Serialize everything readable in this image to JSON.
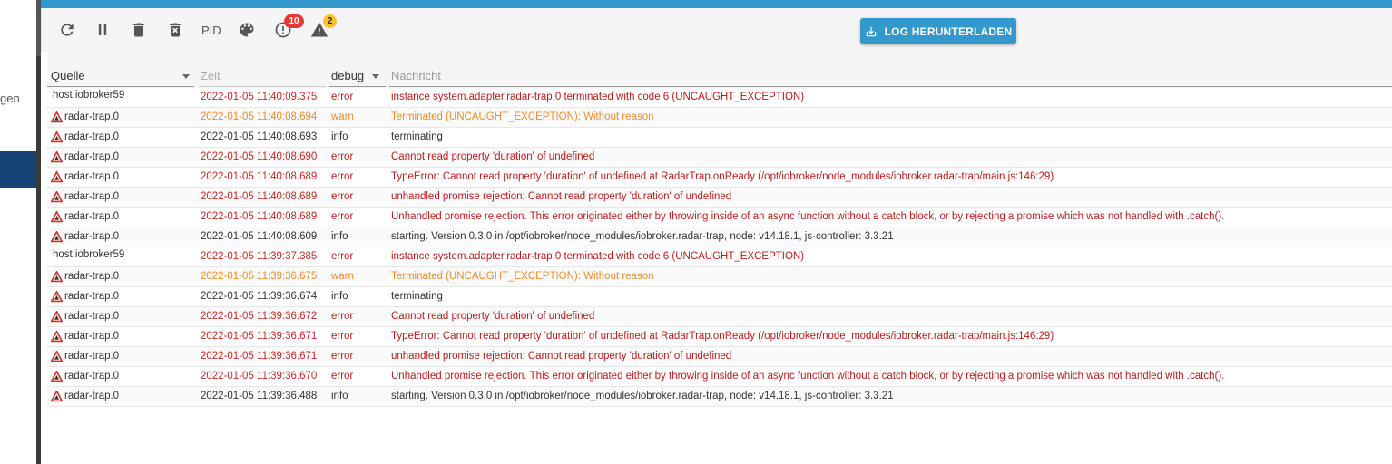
{
  "sidebar": {
    "partial_label": "gen"
  },
  "toolbar": {
    "pid_label": "PID",
    "error_count": "10",
    "warn_count": "2",
    "download_label": "LOG HERUNTERLADEN"
  },
  "table": {
    "headers": {
      "source": "Quelle",
      "time": "Zeit",
      "severity": "debug",
      "message": "Nachricht"
    },
    "rows": [
      {
        "source": "host.iobroker59",
        "icon": "none",
        "time": "2022-01-05 11:40:09.375",
        "severity": "error",
        "message": "instance system.adapter.radar-trap.0 terminated with code 6 (UNCAUGHT_EXCEPTION)"
      },
      {
        "source": "radar-trap.0",
        "icon": "radar-trap-icon",
        "time": "2022-01-05 11:40:08.694",
        "severity": "warn",
        "message": "Terminated (UNCAUGHT_EXCEPTION): Without reason"
      },
      {
        "source": "radar-trap.0",
        "icon": "radar-trap-icon",
        "time": "2022-01-05 11:40:08.693",
        "severity": "info",
        "message": "terminating"
      },
      {
        "source": "radar-trap.0",
        "icon": "radar-trap-icon",
        "time": "2022-01-05 11:40:08.690",
        "severity": "error",
        "message": "Cannot read property 'duration' of undefined"
      },
      {
        "source": "radar-trap.0",
        "icon": "radar-trap-icon",
        "time": "2022-01-05 11:40:08.689",
        "severity": "error",
        "message": "TypeError: Cannot read property 'duration' of undefined at RadarTrap.onReady (/opt/iobroker/node_modules/iobroker.radar-trap/main.js:146:29)"
      },
      {
        "source": "radar-trap.0",
        "icon": "radar-trap-icon",
        "time": "2022-01-05 11:40:08.689",
        "severity": "error",
        "message": "unhandled promise rejection: Cannot read property 'duration' of undefined"
      },
      {
        "source": "radar-trap.0",
        "icon": "radar-trap-icon",
        "time": "2022-01-05 11:40:08.689",
        "severity": "error",
        "message": "Unhandled promise rejection. This error originated either by throwing inside of an async function without a catch block, or by rejecting a promise which was not handled with .catch()."
      },
      {
        "source": "radar-trap.0",
        "icon": "radar-trap-icon",
        "time": "2022-01-05 11:40:08.609",
        "severity": "info",
        "message": "starting. Version 0.3.0 in /opt/iobroker/node_modules/iobroker.radar-trap, node: v14.18.1, js-controller: 3.3.21"
      },
      {
        "source": "host.iobroker59",
        "icon": "none",
        "time": "2022-01-05 11:39:37.385",
        "severity": "error",
        "message": "instance system.adapter.radar-trap.0 terminated with code 6 (UNCAUGHT_EXCEPTION)"
      },
      {
        "source": "radar-trap.0",
        "icon": "radar-trap-icon",
        "time": "2022-01-05 11:39:36.675",
        "severity": "warn",
        "message": "Terminated (UNCAUGHT_EXCEPTION): Without reason"
      },
      {
        "source": "radar-trap.0",
        "icon": "radar-trap-icon",
        "time": "2022-01-05 11:39:36.674",
        "severity": "info",
        "message": "terminating"
      },
      {
        "source": "radar-trap.0",
        "icon": "radar-trap-icon",
        "time": "2022-01-05 11:39:36.672",
        "severity": "error",
        "message": "Cannot read property 'duration' of undefined"
      },
      {
        "source": "radar-trap.0",
        "icon": "radar-trap-icon",
        "time": "2022-01-05 11:39:36.671",
        "severity": "error",
        "message": "TypeError: Cannot read property 'duration' of undefined at RadarTrap.onReady (/opt/iobroker/node_modules/iobroker.radar-trap/main.js:146:29)"
      },
      {
        "source": "radar-trap.0",
        "icon": "radar-trap-icon",
        "time": "2022-01-05 11:39:36.671",
        "severity": "error",
        "message": "unhandled promise rejection: Cannot read property 'duration' of undefined"
      },
      {
        "source": "radar-trap.0",
        "icon": "radar-trap-icon",
        "time": "2022-01-05 11:39:36.670",
        "severity": "error",
        "message": "Unhandled promise rejection. This error originated either by throwing inside of an async function without a catch block, or by rejecting a promise which was not handled with .catch()."
      },
      {
        "source": "radar-trap.0",
        "icon": "radar-trap-icon",
        "time": "2022-01-05 11:39:36.488",
        "severity": "info",
        "message": "starting. Version 0.3.0 in /opt/iobroker/node_modules/iobroker.radar-trap, node: v14.18.1, js-controller: 3.3.21"
      }
    ]
  },
  "colors": {
    "accent": "#3399cc",
    "error": "#b71c1c",
    "warn": "#ef8c29",
    "info": "#333333",
    "sidebar_selected": "#164477"
  }
}
